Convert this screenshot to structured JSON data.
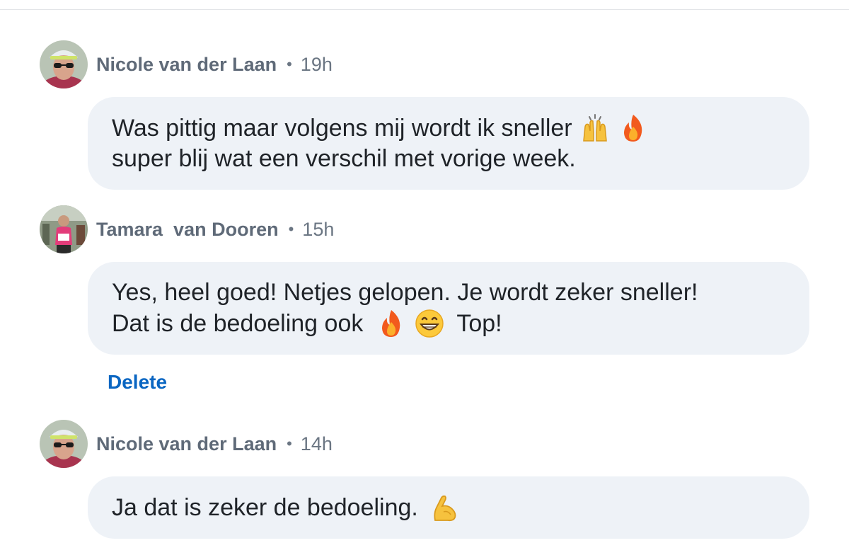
{
  "comments": [
    {
      "author": "Nicole van der Laan",
      "separator": "•",
      "time": "19h",
      "lines": [
        "Was pittig maar volgens mij wordt ik sneller",
        "super blij wat een verschil met vorige week."
      ],
      "emojis": [
        "raising-hands-icon",
        "fire-icon"
      ]
    },
    {
      "author": "Tamara  van Dooren",
      "separator": "•",
      "time": "15h",
      "lines": [
        "Yes, heel goed! Netjes gelopen. Je wordt zeker sneller!",
        "Dat is de bedoeling ook",
        "Top!"
      ],
      "emojis": [
        "fire-icon",
        "grinning-face-icon"
      ],
      "action": "Delete"
    },
    {
      "author": "Nicole van der Laan",
      "separator": "•",
      "time": "14h",
      "lines": [
        "Ja dat is zeker de bedoeling."
      ],
      "emojis": [
        "flexed-biceps-icon"
      ]
    }
  ],
  "colors": {
    "bubble": "#eef2f7",
    "author": "#5f6a78",
    "link": "#0a66c2"
  }
}
